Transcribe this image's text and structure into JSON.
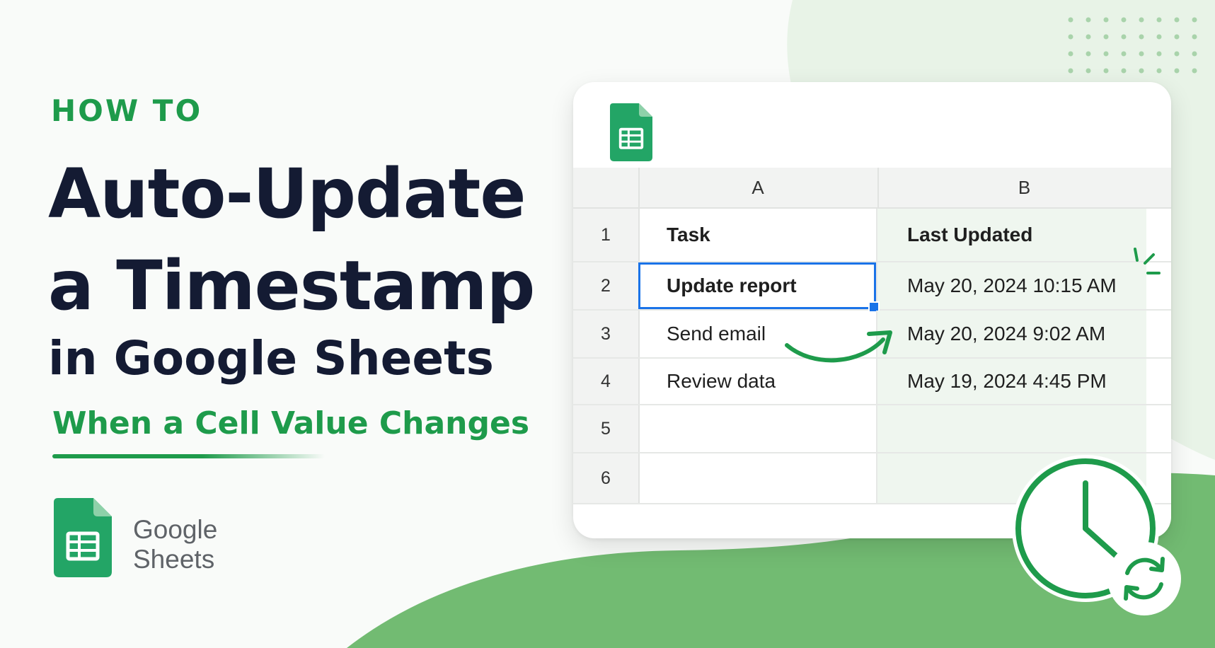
{
  "header": {
    "eyebrow": "HOW TO",
    "title_line_1": "Auto-Update",
    "title_line_2": "a Timestamp",
    "title_line_3": "in Google Sheets",
    "subtitle": "When a Cell Value Changes"
  },
  "brand": {
    "line_1": "Google",
    "line_2": "Sheets",
    "icon": "google-sheets-icon"
  },
  "spreadsheet": {
    "column_headers": [
      "A",
      "B"
    ],
    "rows": [
      {
        "num": "1",
        "a": "Task",
        "b": "Last Updated"
      },
      {
        "num": "2",
        "a": "Update report",
        "b": "May 20, 2024 10:15 AM"
      },
      {
        "num": "3",
        "a": "Send email",
        "b": "May 20, 2024 9:02 AM"
      },
      {
        "num": "4",
        "a": "Review data",
        "b": "May 19, 2024 4:45 PM"
      },
      {
        "num": "5",
        "a": "",
        "b": ""
      },
      {
        "num": "6",
        "a": "",
        "b": ""
      }
    ],
    "selected_cell": "A2"
  },
  "icons": [
    "google-sheets-icon",
    "curved-arrow-icon",
    "clock-icon",
    "refresh-icon",
    "spark-icon",
    "dot-grid"
  ],
  "colors": {
    "brand_green": "#1e9b4b",
    "title_navy": "#141b33",
    "selection_blue": "#1a73e8",
    "light_green": "#e6f2e6",
    "wave_green": "#6fbc72"
  }
}
